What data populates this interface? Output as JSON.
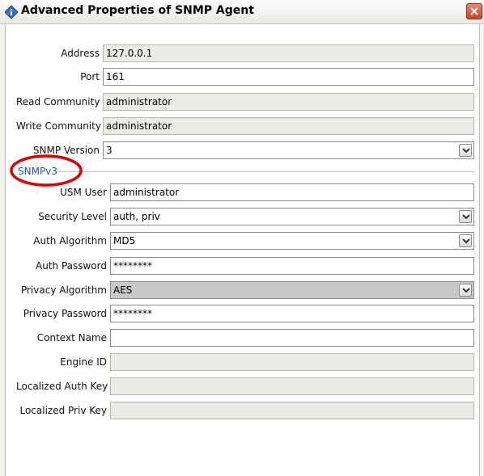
{
  "window": {
    "title": "Advanced Properties of SNMP Agent",
    "accent": "#c8431f"
  },
  "general": {
    "address": {
      "label": "Address",
      "value": "127.0.0.1"
    },
    "port": {
      "label": "Port",
      "value": "161"
    },
    "read_community": {
      "label": "Read Community",
      "value": "administrator"
    },
    "write_community": {
      "label": "Write Community",
      "value": "administrator"
    },
    "snmp_version": {
      "label": "SNMP Version",
      "value": "3"
    }
  },
  "snmpv3": {
    "section_label": "SNMPv3",
    "usm_user": {
      "label": "USM User",
      "value": "administrator"
    },
    "security_level": {
      "label": "Security Level",
      "value": "auth, priv"
    },
    "auth_algorithm": {
      "label": "Auth Algorithm",
      "value": "MD5"
    },
    "auth_password": {
      "label": "Auth Password",
      "value": "********"
    },
    "privacy_algorithm": {
      "label": "Privacy Algorithm",
      "value": "AES"
    },
    "privacy_password": {
      "label": "Privacy Password",
      "value": "********"
    },
    "context_name": {
      "label": "Context Name",
      "value": ""
    },
    "engine_id": {
      "label": "Engine ID",
      "value": ""
    },
    "localized_auth_key": {
      "label": "Localized Auth Key",
      "value": ""
    },
    "localized_priv_key": {
      "label": "Localized Priv Key",
      "value": ""
    }
  },
  "icons": {
    "title": "info-diamond-icon",
    "close": "close-x-icon",
    "dropdown": "chevron-down-icon"
  },
  "annotation": {
    "color": "#e00000"
  }
}
